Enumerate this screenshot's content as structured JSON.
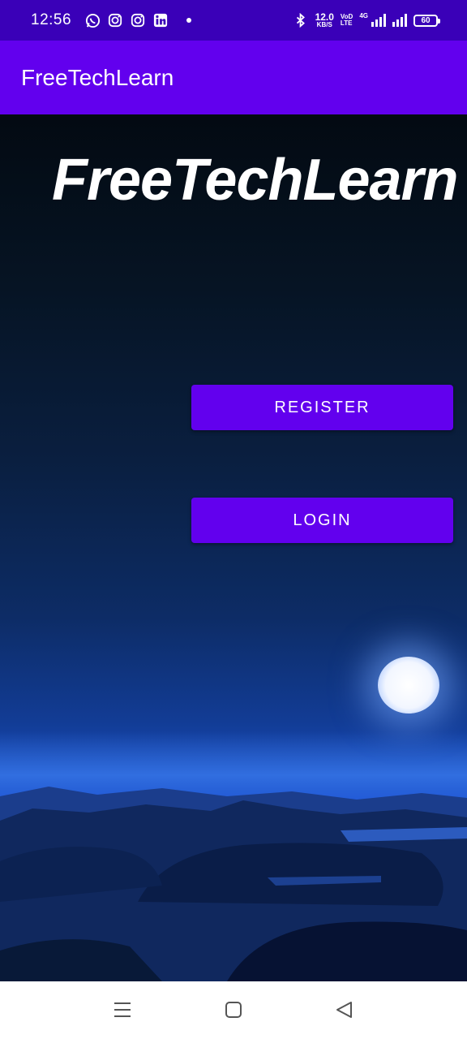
{
  "status_bar": {
    "time": "12:56",
    "notification_icons": [
      "whatsapp-icon",
      "instagram-icon",
      "instagram-icon",
      "linkedin-icon"
    ],
    "speed_value": "12.0",
    "speed_unit": "KB/S",
    "volte_top": "VoD",
    "volte_bottom": "LTE",
    "network_type": "4G",
    "battery": "60"
  },
  "app_bar": {
    "title": "FreeTechLearn",
    "color": "#6200ee"
  },
  "main": {
    "hero_title": "FreeTechLearn",
    "register_label": "REGISTER",
    "login_label": "LOGIN",
    "button_color": "#6200ee"
  },
  "nav_bar": {
    "icons": [
      "recents-icon",
      "home-icon",
      "back-icon"
    ]
  }
}
